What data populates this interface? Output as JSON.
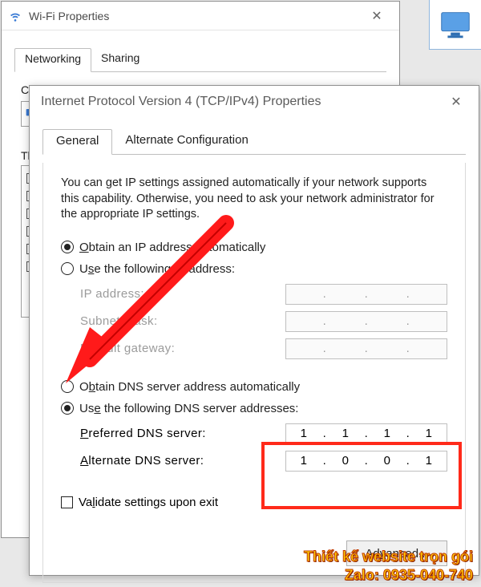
{
  "back_window": {
    "title": "Wi-Fi Properties",
    "tabs": {
      "networking": "Networking",
      "sharing": "Sharing"
    },
    "connect_using_label": "Connect using:",
    "this_conn_label": "This connection uses the following items:"
  },
  "front_window": {
    "title": "Internet Protocol Version 4 (TCP/IPv4) Properties",
    "tabs": {
      "general": "General",
      "alt": "Alternate Configuration"
    },
    "info": "You can get IP settings assigned automatically if your network supports this capability. Otherwise, you need to ask your network administrator for the appropriate IP settings.",
    "radio_ip_auto": "Obtain an IP address automatically",
    "radio_ip_manual": "Use the following IP address:",
    "ip_address_label": "IP address:",
    "subnet_label": "Subnet mask:",
    "gateway_label": "Default gateway:",
    "radio_dns_auto": "Obtain DNS server address automatically",
    "radio_dns_manual": "Use the following DNS server addresses:",
    "pref_dns_label": "Preferred DNS server:",
    "alt_dns_label": "Alternate DNS server:",
    "pref_dns": {
      "a": "1",
      "b": "1",
      "c": "1",
      "d": "1"
    },
    "alt_dns": {
      "a": "1",
      "b": "0",
      "c": "0",
      "d": "1"
    },
    "validate_label": "Validate settings upon exit",
    "advanced_label": "Advanced..."
  },
  "branding": {
    "line1": "Thiết kế website trọn gói",
    "line2": "Zalo: 0935-040-740"
  }
}
